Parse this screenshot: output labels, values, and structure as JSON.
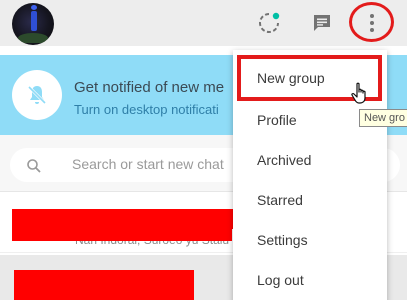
{
  "header": {
    "avatar_icon": "profile-avatar",
    "status_icon": "status-ring-icon",
    "chat_icon": "new-chat-icon",
    "menu_icon": "more-vertical-icon",
    "status_dot_color": "#00bfa5",
    "highlight_color": "#e31b1b"
  },
  "banner": {
    "title": "Get notified of new me",
    "subtitle": "Turn on desktop notificati",
    "icon": "bell-off-icon",
    "background": "#8fdcf7"
  },
  "search": {
    "placeholder": "Search or start new chat",
    "icon": "search-icon"
  },
  "chats": [
    {
      "preview": "Nari Indoral, Suroeo yu Stalu"
    }
  ],
  "menu": {
    "items": [
      {
        "label": "New group"
      },
      {
        "label": "Profile"
      },
      {
        "label": "Archived"
      },
      {
        "label": "Starred"
      },
      {
        "label": "Settings"
      },
      {
        "label": "Log out"
      }
    ]
  },
  "tooltip": {
    "text": "New gro"
  }
}
